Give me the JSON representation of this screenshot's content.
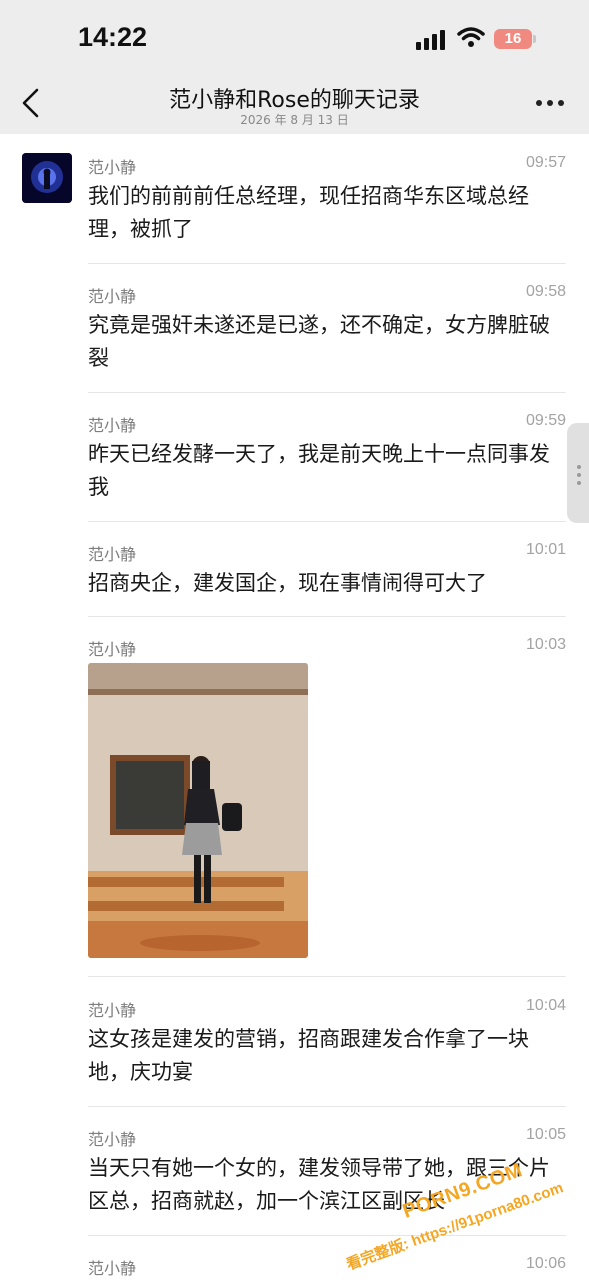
{
  "status_bar": {
    "time": "14:22",
    "battery": "16"
  },
  "nav": {
    "title": "范小静和Rose的聊天记录",
    "date": "2026 年 8 月 13 日"
  },
  "messages": [
    {
      "sender": "范小静",
      "time": "09:57",
      "text": "我们的前前前任总经理，现任招商华东区域总经理，被抓了"
    },
    {
      "sender": "范小静",
      "time": "09:58",
      "text": "究竟是强奸未遂还是已遂，还不确定，女方脾脏破裂"
    },
    {
      "sender": "范小静",
      "time": "09:59",
      "text": "昨天已经发酵一天了，我是前天晚上十一点同事发我"
    },
    {
      "sender": "范小静",
      "time": "10:01",
      "text": "招商央企，建发国企，现在事情闹得可大了"
    },
    {
      "sender": "范小静",
      "time": "10:03",
      "text": ""
    },
    {
      "sender": "范小静",
      "time": "10:04",
      "text": "这女孩是建发的营销，招商跟建发合作拿了一块地，庆功宴"
    },
    {
      "sender": "范小静",
      "time": "10:05",
      "text": "当天只有她一个女的，建发领导带了她，跟三个片区总，招商就赵，加一个滨江区副区长"
    },
    {
      "sender": "范小静",
      "time": "10:06",
      "text": ""
    }
  ],
  "watermark": {
    "line1": "PORN9.COM",
    "line2": "看完整版: https://91porna80.com"
  },
  "colors": {
    "header_bg": "#ededed",
    "battery": "#f08a80",
    "watermark": "#f5a623"
  }
}
